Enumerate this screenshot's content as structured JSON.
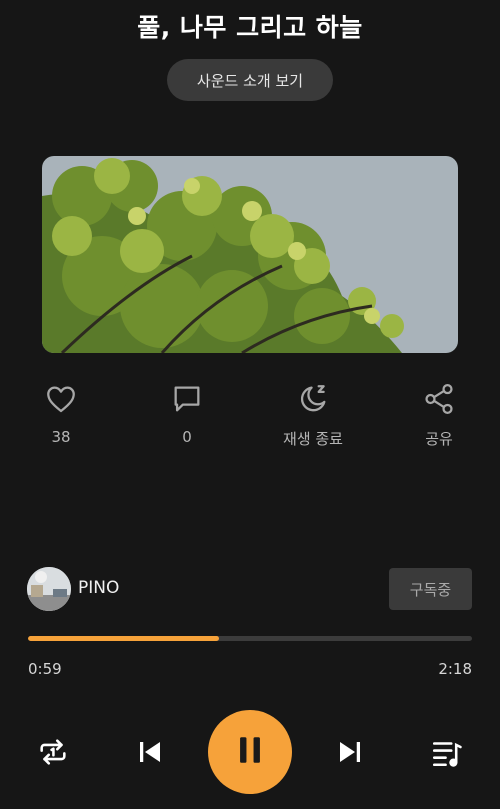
{
  "sound": {
    "title": "풀, 나무 그리고 하늘",
    "intro_button": "사운드 소개 보기"
  },
  "actions": {
    "like": {
      "icon": "heart-icon",
      "label": "38"
    },
    "comment": {
      "icon": "comment-icon",
      "label": "0"
    },
    "sleep_timer": {
      "icon": "moon-icon",
      "label": "재생 종료"
    },
    "share": {
      "icon": "share-icon",
      "label": "공유"
    }
  },
  "artist": {
    "name": "PINO",
    "subscribe_label": "구독중"
  },
  "player": {
    "current_time": "0:59",
    "total_time": "2:18",
    "progress": 0.43
  },
  "controls": [
    "repeat-one-icon",
    "previous-icon",
    "pause-icon",
    "next-icon",
    "playlist-icon"
  ],
  "colors": {
    "background": "#161616",
    "accent": "#f6a23a",
    "button_bg": "#3a3a3a"
  }
}
